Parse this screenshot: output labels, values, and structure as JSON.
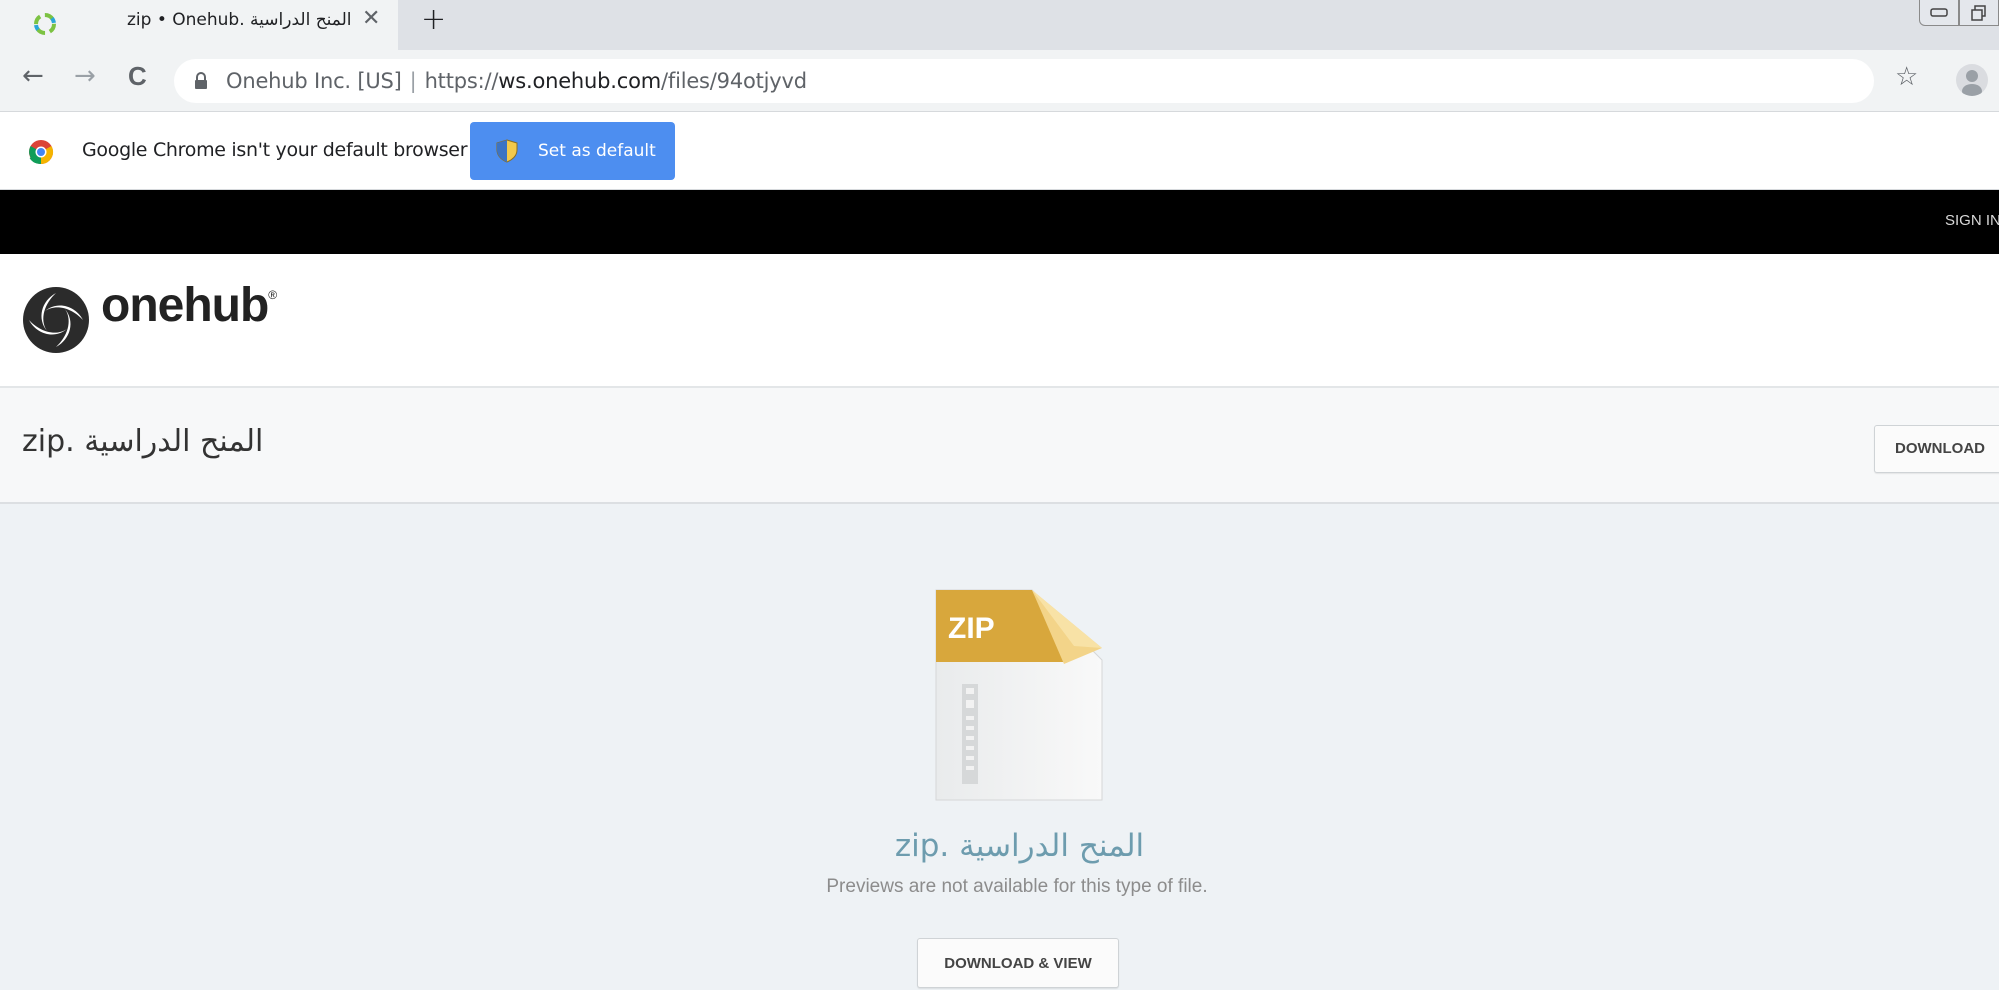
{
  "browser": {
    "tab_title": "zip • Onehub. المنح الدراسية",
    "tab_close_glyph": "✕",
    "new_tab_glyph": "+",
    "url_security_label": "Onehub Inc. [US]",
    "url_scheme": "https://",
    "url_host": "ws.onehub.com",
    "url_path": "/files/94otjyvd",
    "infobar_message": "Google Chrome isn't your default browser",
    "set_default_label": "Set as default",
    "back_glyph": "←",
    "forward_glyph": "→",
    "reload_glyph": "C",
    "bookmark_glyph": "☆"
  },
  "site": {
    "signin_label": "SIGN IN",
    "brand_name": "onehub",
    "brand_mark": "®"
  },
  "file": {
    "title": "zip. المنح الدراسية",
    "download_label": "DOWNLOAD",
    "icon_type_label": "ZIP",
    "preview_name": "zip. المنح الدراسية",
    "preview_message": "Previews are not available for this type of file.",
    "download_view_label": "DOWNLOAD & VIEW"
  },
  "colors": {
    "accent_button": "#4d8ef0",
    "zip_fold": "#e0b046",
    "preview_name_text": "#6d9cae",
    "topbar": "#000000"
  }
}
